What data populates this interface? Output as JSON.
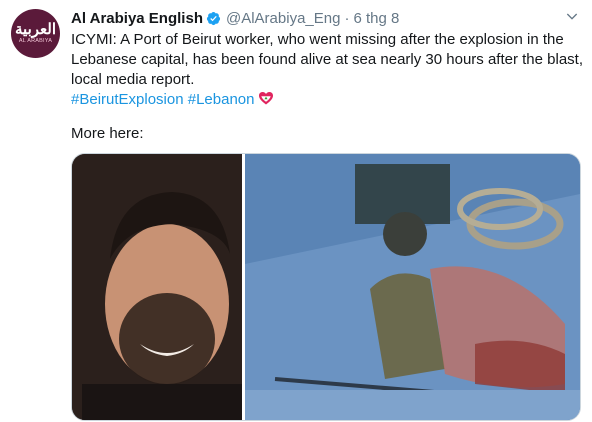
{
  "account": {
    "display_name": "Al Arabiya English",
    "handle": "@AlArabiya_Eng",
    "separator": "·",
    "timestamp": "6 thg 8",
    "avatar_arabic": "العربية",
    "avatar_english": "AL ARABIYA",
    "verified": true
  },
  "tweet": {
    "body": "ICYMI: A Port of Beirut worker, who went missing after the explosion in the Lebanese capital, has been found alive at sea nearly 30 hours after the blast, local media report.",
    "hashtags": [
      "#BeirutExplosion",
      "#Lebanon"
    ],
    "more_text": "More here:"
  },
  "media": {
    "photos": [
      {
        "description_icon": "portrait-photo"
      },
      {
        "description_icon": "boat-rescue-photo"
      }
    ]
  },
  "colors": {
    "link": "#1b95e0",
    "verified": "#1da1f2",
    "secondary_text": "#657786",
    "avatar_bg": "#5b1a3a"
  }
}
